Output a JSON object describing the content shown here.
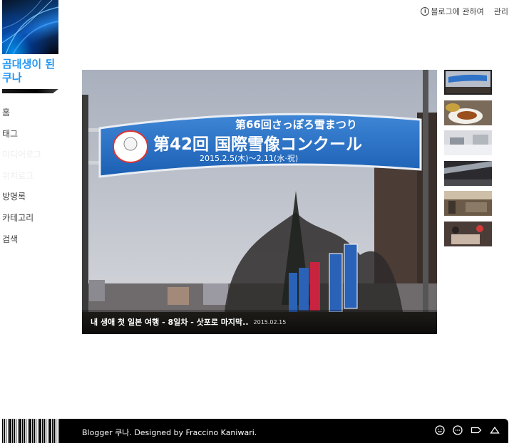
{
  "sidebar": {
    "title": "곰대생이 된 쿠나",
    "nav": [
      {
        "label": "홈",
        "faded": false
      },
      {
        "label": "태그",
        "faded": false
      },
      {
        "label": "미디어로그",
        "faded": true
      },
      {
        "label": "위치로그",
        "faded": true
      },
      {
        "label": "방명록",
        "faded": false
      },
      {
        "label": "카테고리",
        "faded": false
      },
      {
        "label": "검색",
        "faded": false
      }
    ]
  },
  "header": {
    "about_label": "블로그에 관하여",
    "admin_label": "관리"
  },
  "featured": {
    "title": "내 생애 첫 일본 여행 - 8일차 - 삿포로 마지막..",
    "date": "2015.02.15",
    "banner": {
      "line1": "第66回さっぽろ雪まつり",
      "line2": "第42回 国際雪像コンクール",
      "line3": "2015.2.5(木)〜2.11(水·祝)"
    }
  },
  "thumbnails": [
    {
      "subject": "sapporo-banner",
      "active": true
    },
    {
      "subject": "curry-dish",
      "active": false
    },
    {
      "subject": "snow-park",
      "active": false
    },
    {
      "subject": "station-roof",
      "active": false
    },
    {
      "subject": "shop-interior",
      "active": false
    },
    {
      "subject": "people-table",
      "active": false
    }
  ],
  "footer": {
    "text": "Blogger 쿠나. Designed by Fraccino Kaniwari.",
    "icons": [
      "smile-icon",
      "chat-icon",
      "tag-icon",
      "up-arrow-icon"
    ]
  },
  "colors": {
    "accent": "#2196f3",
    "footer_bg": "#000000"
  }
}
